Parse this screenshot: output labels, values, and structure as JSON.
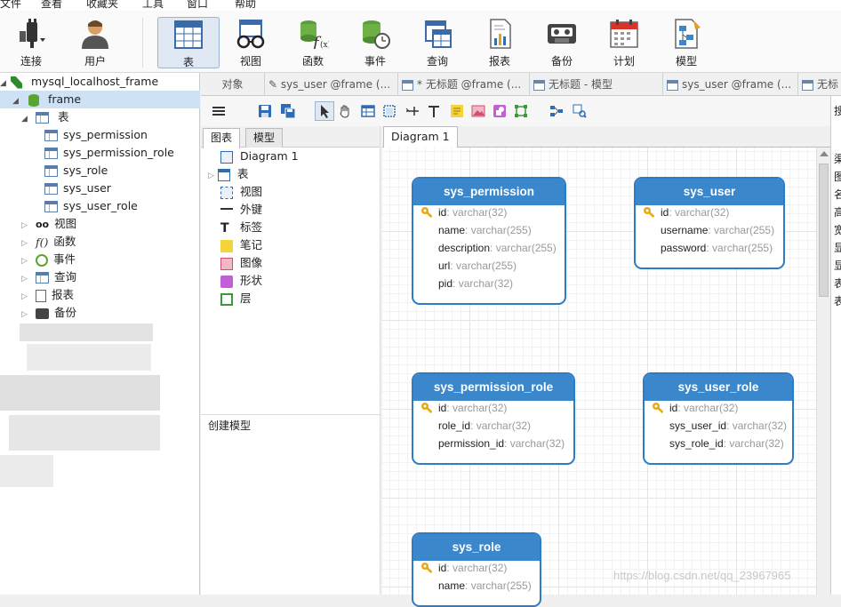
{
  "menu": [
    "文件",
    "查看",
    "收藏夹",
    "工具",
    "窗口",
    "帮助"
  ],
  "toolbar": {
    "buttons": [
      {
        "label": "连接",
        "icon": "plug-icon"
      },
      {
        "label": "用户",
        "icon": "user-icon"
      },
      {
        "label": "表",
        "icon": "table-icon"
      },
      {
        "label": "视图",
        "icon": "glasses-icon"
      },
      {
        "label": "函数",
        "icon": "function-icon"
      },
      {
        "label": "事件",
        "icon": "event-icon"
      },
      {
        "label": "查询",
        "icon": "query-icon"
      },
      {
        "label": "报表",
        "icon": "report-icon"
      },
      {
        "label": "备份",
        "icon": "backup-icon"
      },
      {
        "label": "计划",
        "icon": "calendar-icon"
      },
      {
        "label": "模型",
        "icon": "model-icon"
      }
    ],
    "active": "表"
  },
  "tree": {
    "connection": "mysql_localhost_frame",
    "database": "frame",
    "tables_label": "表",
    "tables": [
      "sys_permission",
      "sys_permission_role",
      "sys_role",
      "sys_user",
      "sys_user_role"
    ],
    "groups": [
      "视图",
      "函数",
      "事件",
      "查询",
      "报表",
      "备份"
    ]
  },
  "tabs": [
    "对象",
    "sys_user @frame (...",
    "* 无标题 @frame (...",
    "无标题 - 模型",
    "sys_user @frame (...",
    "无标"
  ],
  "left_panel": {
    "tab_diagram": "图表",
    "tab_model": "模型",
    "items": [
      "Diagram 1",
      "表",
      "视图",
      "外键",
      "标签",
      "笔记",
      "图像",
      "形状",
      "层"
    ],
    "bottom_label": "创建模型"
  },
  "diagram_tab": "Diagram 1",
  "search_label": "搜",
  "right_chars": [
    "渠",
    "图",
    "名",
    "高",
    "宽",
    "显",
    "显",
    "表",
    "表"
  ],
  "entities": [
    {
      "name": "sys_permission",
      "fields": [
        {
          "name": "id",
          "type": "varchar(32)",
          "key": true
        },
        {
          "name": "name",
          "type": "varchar(255)"
        },
        {
          "name": "description",
          "type": "varchar(255)"
        },
        {
          "name": "url",
          "type": "varchar(255)"
        },
        {
          "name": "pid",
          "type": "varchar(32)"
        }
      ]
    },
    {
      "name": "sys_user",
      "fields": [
        {
          "name": "id",
          "type": "varchar(32)",
          "key": true
        },
        {
          "name": "username",
          "type": "varchar(255)"
        },
        {
          "name": "password",
          "type": "varchar(255)"
        }
      ]
    },
    {
      "name": "sys_permission_role",
      "fields": [
        {
          "name": "id",
          "type": "varchar(32)",
          "key": true
        },
        {
          "name": "role_id",
          "type": "varchar(32)"
        },
        {
          "name": "permission_id",
          "type": "varchar(32)"
        }
      ]
    },
    {
      "name": "sys_user_role",
      "fields": [
        {
          "name": "id",
          "type": "varchar(32)",
          "key": true
        },
        {
          "name": "sys_user_id",
          "type": "varchar(32)"
        },
        {
          "name": "sys_role_id",
          "type": "varchar(32)"
        }
      ]
    },
    {
      "name": "sys_role",
      "fields": [
        {
          "name": "id",
          "type": "varchar(32)",
          "key": true
        },
        {
          "name": "name",
          "type": "varchar(255)"
        }
      ]
    }
  ],
  "watermark": "https://blog.csdn.net/qq_23967965",
  "colors": {
    "entity_header": "#3a87cc",
    "entity_border": "#2c7bc4",
    "key": "#e6a817"
  }
}
